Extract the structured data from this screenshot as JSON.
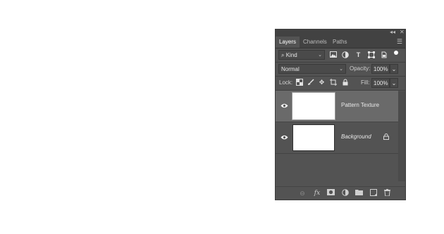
{
  "panel": {
    "tabs": [
      "Layers",
      "Channels",
      "Paths"
    ],
    "active_tab": "Layers",
    "collapse_icon": "collapse-arrows-icon",
    "close_icon": "close-icon",
    "menu_icon": "panel-menu-icon"
  },
  "filter": {
    "kind_label": "Kind",
    "search_icon": "search-icon",
    "filter_icons": [
      "image-filter-icon",
      "adjustment-filter-icon",
      "type-filter-icon",
      "shape-filter-icon",
      "smartobject-filter-icon"
    ]
  },
  "blend": {
    "mode": "Normal",
    "opacity_label": "Opacity:",
    "opacity_value": "100%"
  },
  "lock": {
    "label": "Lock:",
    "fill_label": "Fill:",
    "fill_value": "100%"
  },
  "layers": [
    {
      "name": "Pattern Texture",
      "visible": true,
      "selected": true,
      "locked": false
    },
    {
      "name": "Background",
      "visible": true,
      "selected": false,
      "locked": true
    }
  ],
  "colors": {
    "panel_bg": "#535353",
    "header_bg": "#424242",
    "selected_layer": "#6a6a6a"
  }
}
